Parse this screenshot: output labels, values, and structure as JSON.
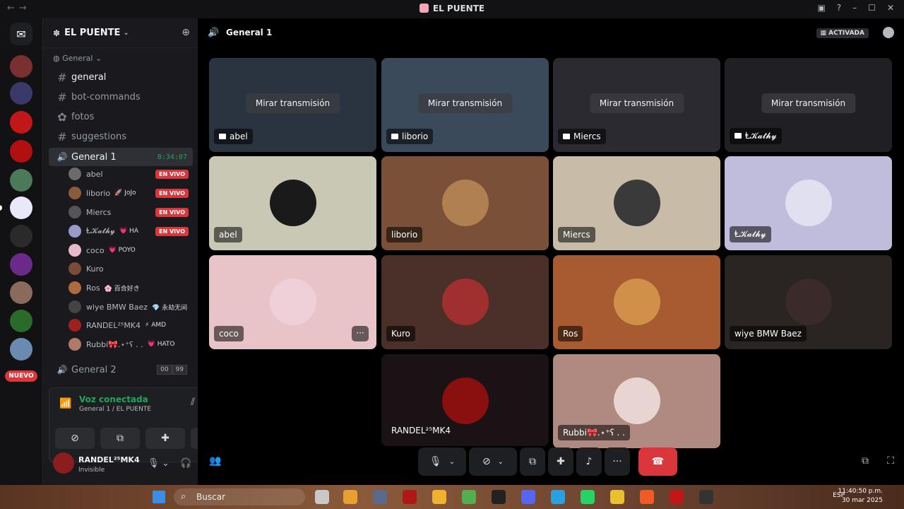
{
  "window": {
    "title": "EL PUENTE",
    "nav_back": "←",
    "nav_forward": "→"
  },
  "rail": {
    "dm_glyph": "✉",
    "new_badge": "NUEVO"
  },
  "sidebar": {
    "guild_name": "EL PUENTE",
    "category": "General",
    "channels": [
      {
        "label": "general"
      },
      {
        "label": "bot-commands"
      },
      {
        "label": "fotos"
      },
      {
        "label": "suggestions"
      }
    ],
    "voice_active": {
      "label": "General 1",
      "timer": "8:34:07"
    },
    "members": [
      {
        "name": "abel",
        "tag": "",
        "live": "EN VIVO",
        "color": "#6b6b6b"
      },
      {
        "name": "liborio",
        "tag": "🚀 JoJo",
        "live": "EN VIVO",
        "color": "#8a5a3a"
      },
      {
        "name": "Miercs",
        "tag": "",
        "live": "EN VIVO",
        "color": "#555555"
      },
      {
        "name": "Ⱡ𝓚𝓪𝓽𝓱𝔂",
        "tag": "💗 HA",
        "live": "EN VIVO",
        "color": "#9a9ac8"
      },
      {
        "name": "coco",
        "tag": "💗 POYO",
        "live": "",
        "color": "#e8b8c8"
      },
      {
        "name": "Kuro",
        "tag": "",
        "live": "",
        "color": "#7a4a3a"
      },
      {
        "name": "Ros",
        "tag": "🌸 百合好き",
        "live": "",
        "color": "#b06a40"
      },
      {
        "name": "wiye BMW Baez",
        "tag": "💎 永劫无间",
        "live": "",
        "color": "#444444"
      },
      {
        "name": "RANDEL²⁵MK4",
        "tag": "⚡ AMD",
        "live": "",
        "color": "#a02020"
      },
      {
        "name": "Rubbi🎀.⋆⁺ʕ . .",
        "tag": "💗 HATO",
        "live": "",
        "color": "#b07a6a"
      }
    ],
    "voice_other": {
      "label": "General 2",
      "count_a": "00",
      "count_b": "99"
    }
  },
  "voice_panel": {
    "status": "Voz conectada",
    "location": "General 1 / EL PUENTE"
  },
  "user_panel": {
    "name": "RANDEL²⁵MK4",
    "status": "Invisible"
  },
  "main": {
    "channel_title": "General 1",
    "activity_badge": "ACTIVADA",
    "watch_label": "Mirar transmisión",
    "streams": [
      {
        "name": "abel",
        "bg": "#2a3440"
      },
      {
        "name": "liborio",
        "bg": "#3a4a5a"
      },
      {
        "name": "Miercs",
        "bg": "#2a2a30"
      },
      {
        "name": "Ⱡ𝓚𝓪𝓽𝓱𝔂",
        "bg": "#202024"
      }
    ],
    "participants": [
      {
        "name": "abel",
        "bg": "#c8c8b4",
        "avatar": "#1a1a1a"
      },
      {
        "name": "liborio",
        "bg": "#7a5038",
        "avatar": "#b08050"
      },
      {
        "name": "Miercs",
        "bg": "#c8bca8",
        "avatar": "#3a3a3a"
      },
      {
        "name": "Ⱡ𝓚𝓪𝓽𝓱𝔂",
        "bg": "#c0bcdc",
        "avatar": "#e0e0f0"
      },
      {
        "name": "coco",
        "bg": "#e8c4c8",
        "avatar": "#f0d0d8"
      },
      {
        "name": "Kuro",
        "bg": "#4a3028",
        "avatar": "#a03030"
      },
      {
        "name": "Ros",
        "bg": "#a85a30",
        "avatar": "#d0904a"
      },
      {
        "name": "wiye BMW Baez",
        "bg": "#2a2422",
        "avatar": "#3a2a2a"
      },
      {
        "name": "RANDEL²⁵MK4",
        "bg": "#1a1214",
        "avatar": "#8a1010"
      },
      {
        "name": "Rubbi🎀.⋆⁺ʕ . .",
        "bg": "#b08a80",
        "avatar": "#e8d4d0"
      }
    ],
    "more_glyph": "···"
  },
  "taskbar": {
    "search_placeholder": "Buscar",
    "lang": "ESP",
    "time": "11:40:50 p.m.",
    "date": "30 mar 2025"
  },
  "colors": {
    "accent_green": "#23a55a",
    "live_red": "#da373c",
    "hangup_red": "#da373c"
  }
}
